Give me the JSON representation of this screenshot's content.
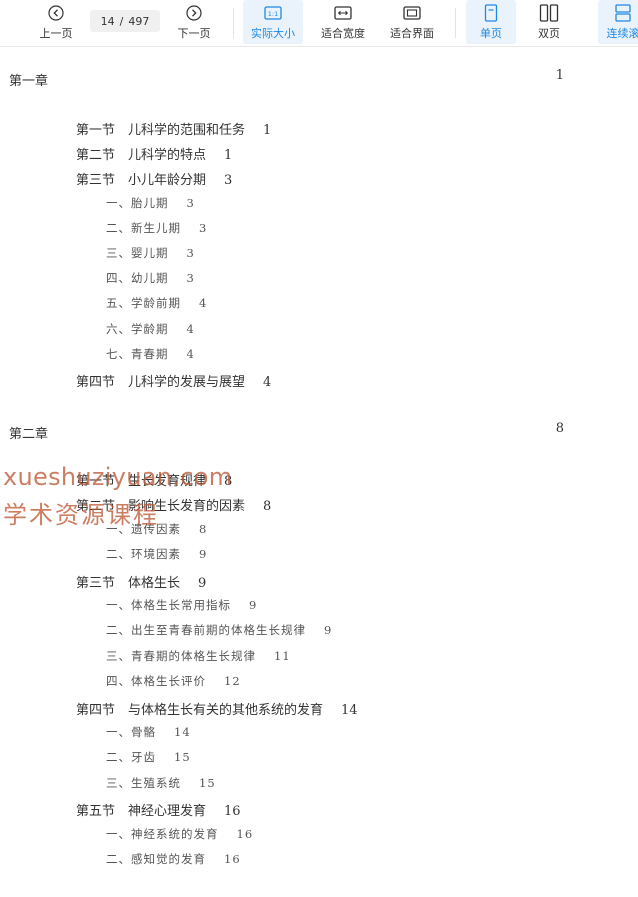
{
  "toolbar": {
    "prev_label": "上一页",
    "next_label": "下一页",
    "page_current": "14",
    "page_sep": "/",
    "page_total": "497",
    "actual_size_label": "实际大小",
    "fit_width_label": "适合宽度",
    "fit_page_label": "适合界面",
    "single_label": "单页",
    "double_label": "双页",
    "continuous_label": "连续滚",
    "accent_color": "#1e88e5"
  },
  "toc": {
    "chapter1": {
      "label": "第一章",
      "page": "1"
    },
    "chapter1_sections": [
      {
        "label": "第一节　儿科学的范围和任务",
        "page": "1"
      },
      {
        "label": "第二节　儿科学的特点",
        "page": "1"
      },
      {
        "label": "第三节　小儿年龄分期",
        "page": "3"
      },
      {
        "label": "一、胎儿期",
        "page": "3"
      },
      {
        "label": "二、新生儿期",
        "page": "3"
      },
      {
        "label": "三、婴儿期",
        "page": "3"
      },
      {
        "label": "四、幼儿期",
        "page": "3"
      },
      {
        "label": "五、学龄前期",
        "page": "4"
      },
      {
        "label": "六、学龄期",
        "page": "4"
      },
      {
        "label": "七、青春期",
        "page": "4"
      },
      {
        "label": "第四节　儿科学的发展与展望",
        "page": "4"
      }
    ],
    "chapter2": {
      "label": "第二章",
      "page": "8"
    },
    "chapter2_sections": [
      {
        "label": "第一节　生长发育规律",
        "page": "8"
      },
      {
        "label": "第二节　影响生长发育的因素",
        "page": "8"
      },
      {
        "label": "一、遗传因素",
        "page": "8"
      },
      {
        "label": "二、环境因素",
        "page": "9"
      },
      {
        "label": "第三节　体格生长",
        "page": "9"
      },
      {
        "label": "一、体格生长常用指标",
        "page": "9"
      },
      {
        "label": "二、出生至青春前期的体格生长规律",
        "page": "9"
      },
      {
        "label": "三、青春期的体格生长规律",
        "page": "11"
      },
      {
        "label": "四、体格生长评价",
        "page": "12"
      },
      {
        "label": "第四节　与体格生长有关的其他系统的发育",
        "page": "14"
      },
      {
        "label": "一、骨骼",
        "page": "14"
      },
      {
        "label": "二、牙齿",
        "page": "15"
      },
      {
        "label": "三、生殖系统",
        "page": "15"
      },
      {
        "label": "第五节　神经心理发育",
        "page": "16"
      },
      {
        "label": "一、神经系统的发育",
        "page": "16"
      },
      {
        "label": "二、感知觉的发育",
        "page": "16"
      }
    ]
  },
  "watermark": {
    "line1": "xueshuziyuan.com",
    "line2": "学术资源课程"
  }
}
